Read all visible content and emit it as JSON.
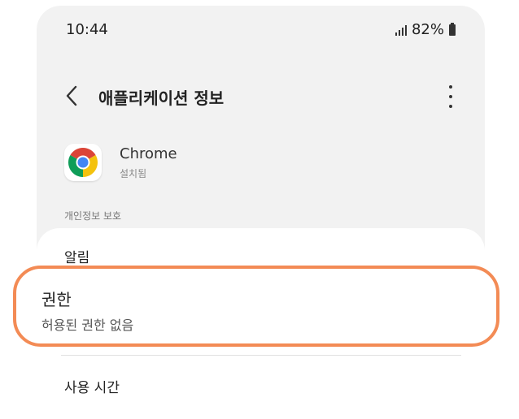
{
  "status_bar": {
    "time": "10:44",
    "battery": "82%"
  },
  "app_bar": {
    "title": "애플리케이션 정보"
  },
  "app": {
    "name": "Chrome",
    "status": "설치됨",
    "icon": "chrome-icon"
  },
  "section": {
    "label": "개인정보 보호"
  },
  "rows": {
    "notifications": "알림",
    "permissions_title": "권한",
    "permissions_subtitle": "허용된 권한 없음",
    "usage_time": "사용 시간"
  },
  "colors": {
    "highlight_border": "#f38b55",
    "screen_bg": "#f2f2f2",
    "card_bg": "#ffffff"
  }
}
